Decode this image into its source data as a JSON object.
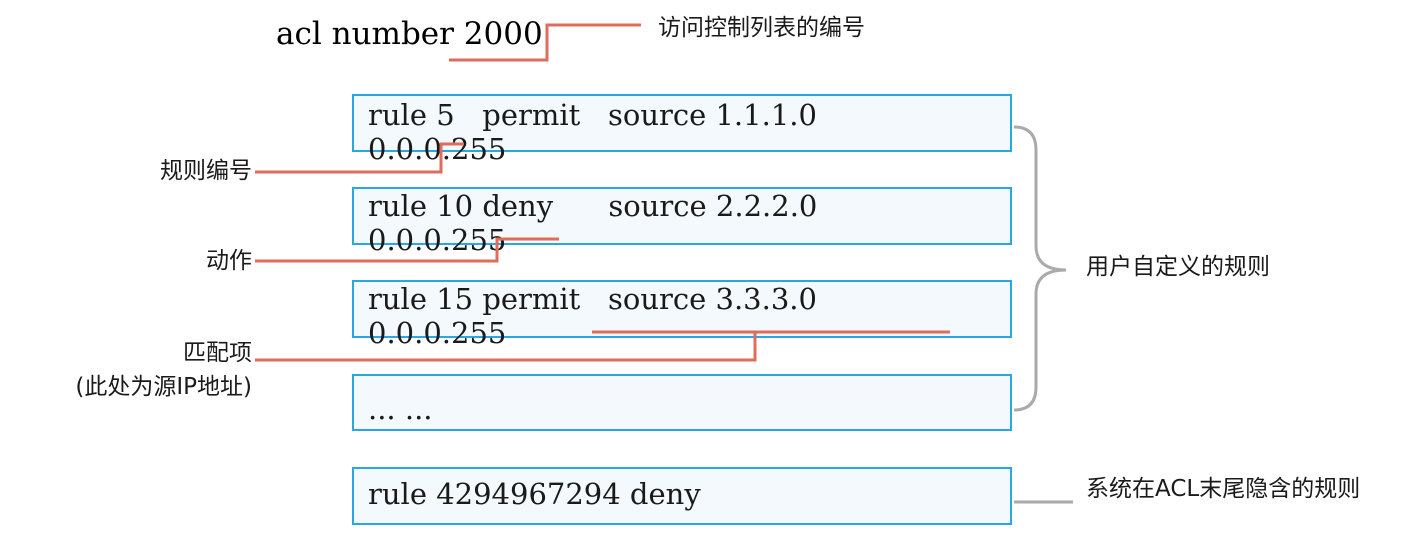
{
  "acl": {
    "title": "acl number 2000"
  },
  "rules": [
    {
      "line1": "rule 5   permit   source 1.1.1.0",
      "line2": "0.0.0.255"
    },
    {
      "line1": "rule 10 deny      source 2.2.2.0",
      "line2": "0.0.0.255"
    },
    {
      "line1": "rule 15 permit   source 3.3.3.0",
      "line2": "0.0.0.255"
    },
    {
      "line1": "... ...",
      "line2": ""
    }
  ],
  "implicit_rule": {
    "text": "rule 4294967294 deny"
  },
  "annotations": {
    "acl_number": "访问控制列表的编号",
    "rule_number": "规则编号",
    "action": "动作",
    "match": "匹配项",
    "match_note": "(此处为源IP地址)",
    "user_defined": "用户自定义的规则",
    "implicit": "系统在ACL末尾隐含的规则"
  },
  "colors": {
    "callout_line": "#e06c5c",
    "brace": "#aaaaaa",
    "box_border": "#29a7e1",
    "box_fill": "#f3f9fc"
  }
}
